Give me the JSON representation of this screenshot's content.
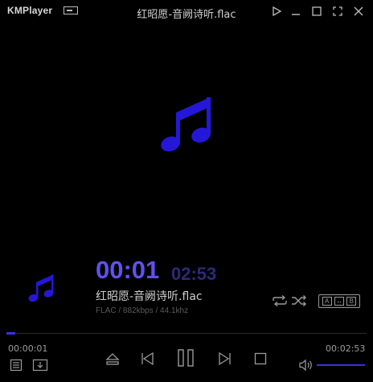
{
  "app": {
    "logo": "KMPlayer",
    "window_title": "红昭愿-音阙诗听.flac"
  },
  "titlebar": {
    "buttons": [
      "play-icon",
      "minimize-icon",
      "maximize-icon",
      "fullscreen-icon",
      "close-icon"
    ]
  },
  "player": {
    "current_time": "00:01",
    "total_time": "02:53",
    "track_name": "红昭愿-音阙诗听.flac",
    "track_info": "FLAC / 882kbps / 44.1khz",
    "ab_repeat": [
      "A",
      "↔",
      "B"
    ],
    "elapsed": "00:00:01",
    "duration": "00:02:53",
    "seek_progress": 0.024,
    "volume_level": 1.0
  },
  "colors": {
    "accent": "#3a30e0",
    "time_current": "#6150f0",
    "time_total": "#2b2a7a",
    "background": "#000000"
  }
}
